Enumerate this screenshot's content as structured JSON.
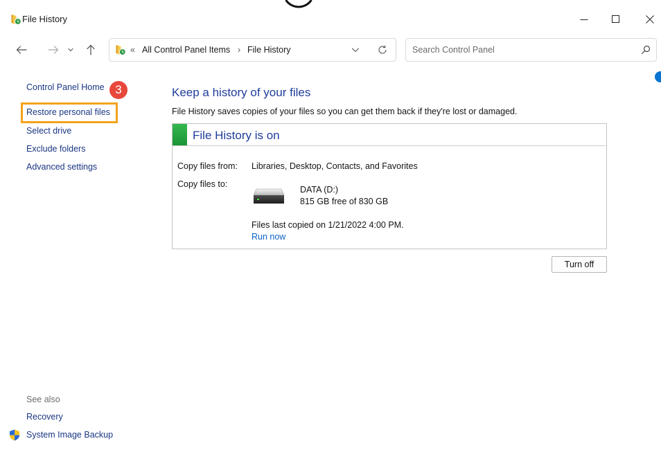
{
  "window": {
    "title": "File History",
    "icon": "file-history-icon",
    "controls": [
      "minimize-icon",
      "maximize-icon",
      "close-icon"
    ]
  },
  "nav": {
    "back_icon": "arrow-left-icon",
    "forward_icon": "arrow-right-icon",
    "recent_icon": "chevron-down-icon",
    "up_icon": "arrow-up-icon"
  },
  "address": {
    "icon": "file-history-icon",
    "overflow": "«",
    "path": [
      "All Control Panel Items",
      "File History"
    ],
    "separator": "›",
    "dropdown_icon": "chevron-down-icon",
    "refresh_icon": "refresh-icon"
  },
  "search": {
    "placeholder": "Search Control Panel",
    "icon": "search-icon"
  },
  "help": {
    "icon": "help-icon"
  },
  "sidebar": {
    "home": "Control Panel Home",
    "links": [
      "Restore personal files",
      "Select drive",
      "Exclude folders",
      "Advanced settings"
    ],
    "see_also_label": "See also",
    "see_also": [
      {
        "label": "Recovery"
      },
      {
        "label": "System Image Backup",
        "icon": "uac-shield-icon"
      }
    ]
  },
  "annotation": {
    "step": "3"
  },
  "main": {
    "heading": "Keep a history of your files",
    "description": "File History saves copies of your files so you can get them back if they're lost or damaged.",
    "status": {
      "title": "File History is on",
      "copy_from_label": "Copy files from:",
      "copy_from_value": "Libraries, Desktop, Contacts, and Favorites",
      "copy_to_label": "Copy files to:",
      "drive_icon": "hard-drive-icon",
      "drive_name": "DATA (D:)",
      "drive_space": "815 GB free of 830 GB",
      "last_copied": "Files last copied on 1/21/2022 4:00 PM.",
      "run_now": "Run now"
    },
    "turn_off": "Turn off"
  },
  "colors": {
    "sidebar_link": "#1a3683",
    "heading": "#1f3d9b",
    "link": "#0b62c4",
    "status_on": "#22a33f",
    "highlight_border": "#f3a21d",
    "badge": "#e8473c",
    "help": "#0a74d1"
  }
}
